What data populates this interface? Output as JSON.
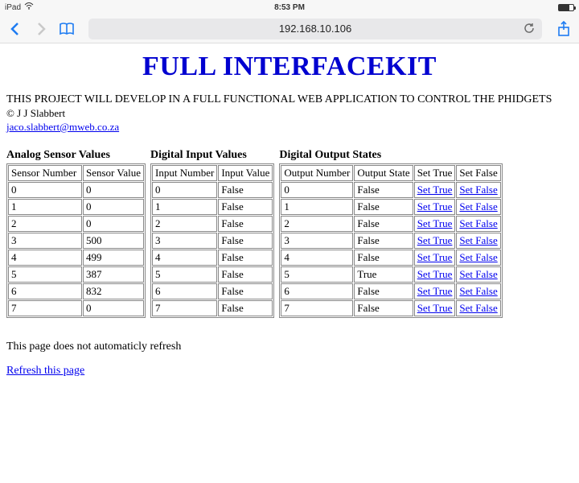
{
  "status": {
    "carrier": "iPad",
    "time": "8:53 PM"
  },
  "toolbar": {
    "address": "192.168.10.106"
  },
  "page": {
    "title": "FULL INTERFACEKIT",
    "description": "THIS PROJECT WILL DEVELOP IN A FULL FUNCTIONAL WEB APPLICATION TO CONTROL THE PHIDGETS",
    "copyright": "© J J Slabbert",
    "email": "jaco.slabbert@mweb.co.za",
    "footer_note": "This page does not automaticly refresh",
    "refresh_label": "Refresh this page"
  },
  "tables": {
    "analog": {
      "title": "Analog Sensor Values",
      "headers": [
        "Sensor Number",
        "Sensor Value"
      ],
      "rows": [
        [
          "0",
          "0"
        ],
        [
          "1",
          "0"
        ],
        [
          "2",
          "0"
        ],
        [
          "3",
          "500"
        ],
        [
          "4",
          "499"
        ],
        [
          "5",
          "387"
        ],
        [
          "6",
          "832"
        ],
        [
          "7",
          "0"
        ]
      ]
    },
    "digital_in": {
      "title": "Digital Input Values",
      "headers": [
        "Input Number",
        "Input Value"
      ],
      "rows": [
        [
          "0",
          "False"
        ],
        [
          "1",
          "False"
        ],
        [
          "2",
          "False"
        ],
        [
          "3",
          "False"
        ],
        [
          "4",
          "False"
        ],
        [
          "5",
          "False"
        ],
        [
          "6",
          "False"
        ],
        [
          "7",
          "False"
        ]
      ]
    },
    "digital_out": {
      "title": "Digital Output States",
      "headers": [
        "Output Number",
        "Output State",
        "Set True",
        "Set False"
      ],
      "set_true_label": "Set True",
      "set_false_label": "Set False",
      "rows": [
        [
          "0",
          "False"
        ],
        [
          "1",
          "False"
        ],
        [
          "2",
          "False"
        ],
        [
          "3",
          "False"
        ],
        [
          "4",
          "False"
        ],
        [
          "5",
          "True"
        ],
        [
          "6",
          "False"
        ],
        [
          "7",
          "False"
        ]
      ]
    }
  }
}
